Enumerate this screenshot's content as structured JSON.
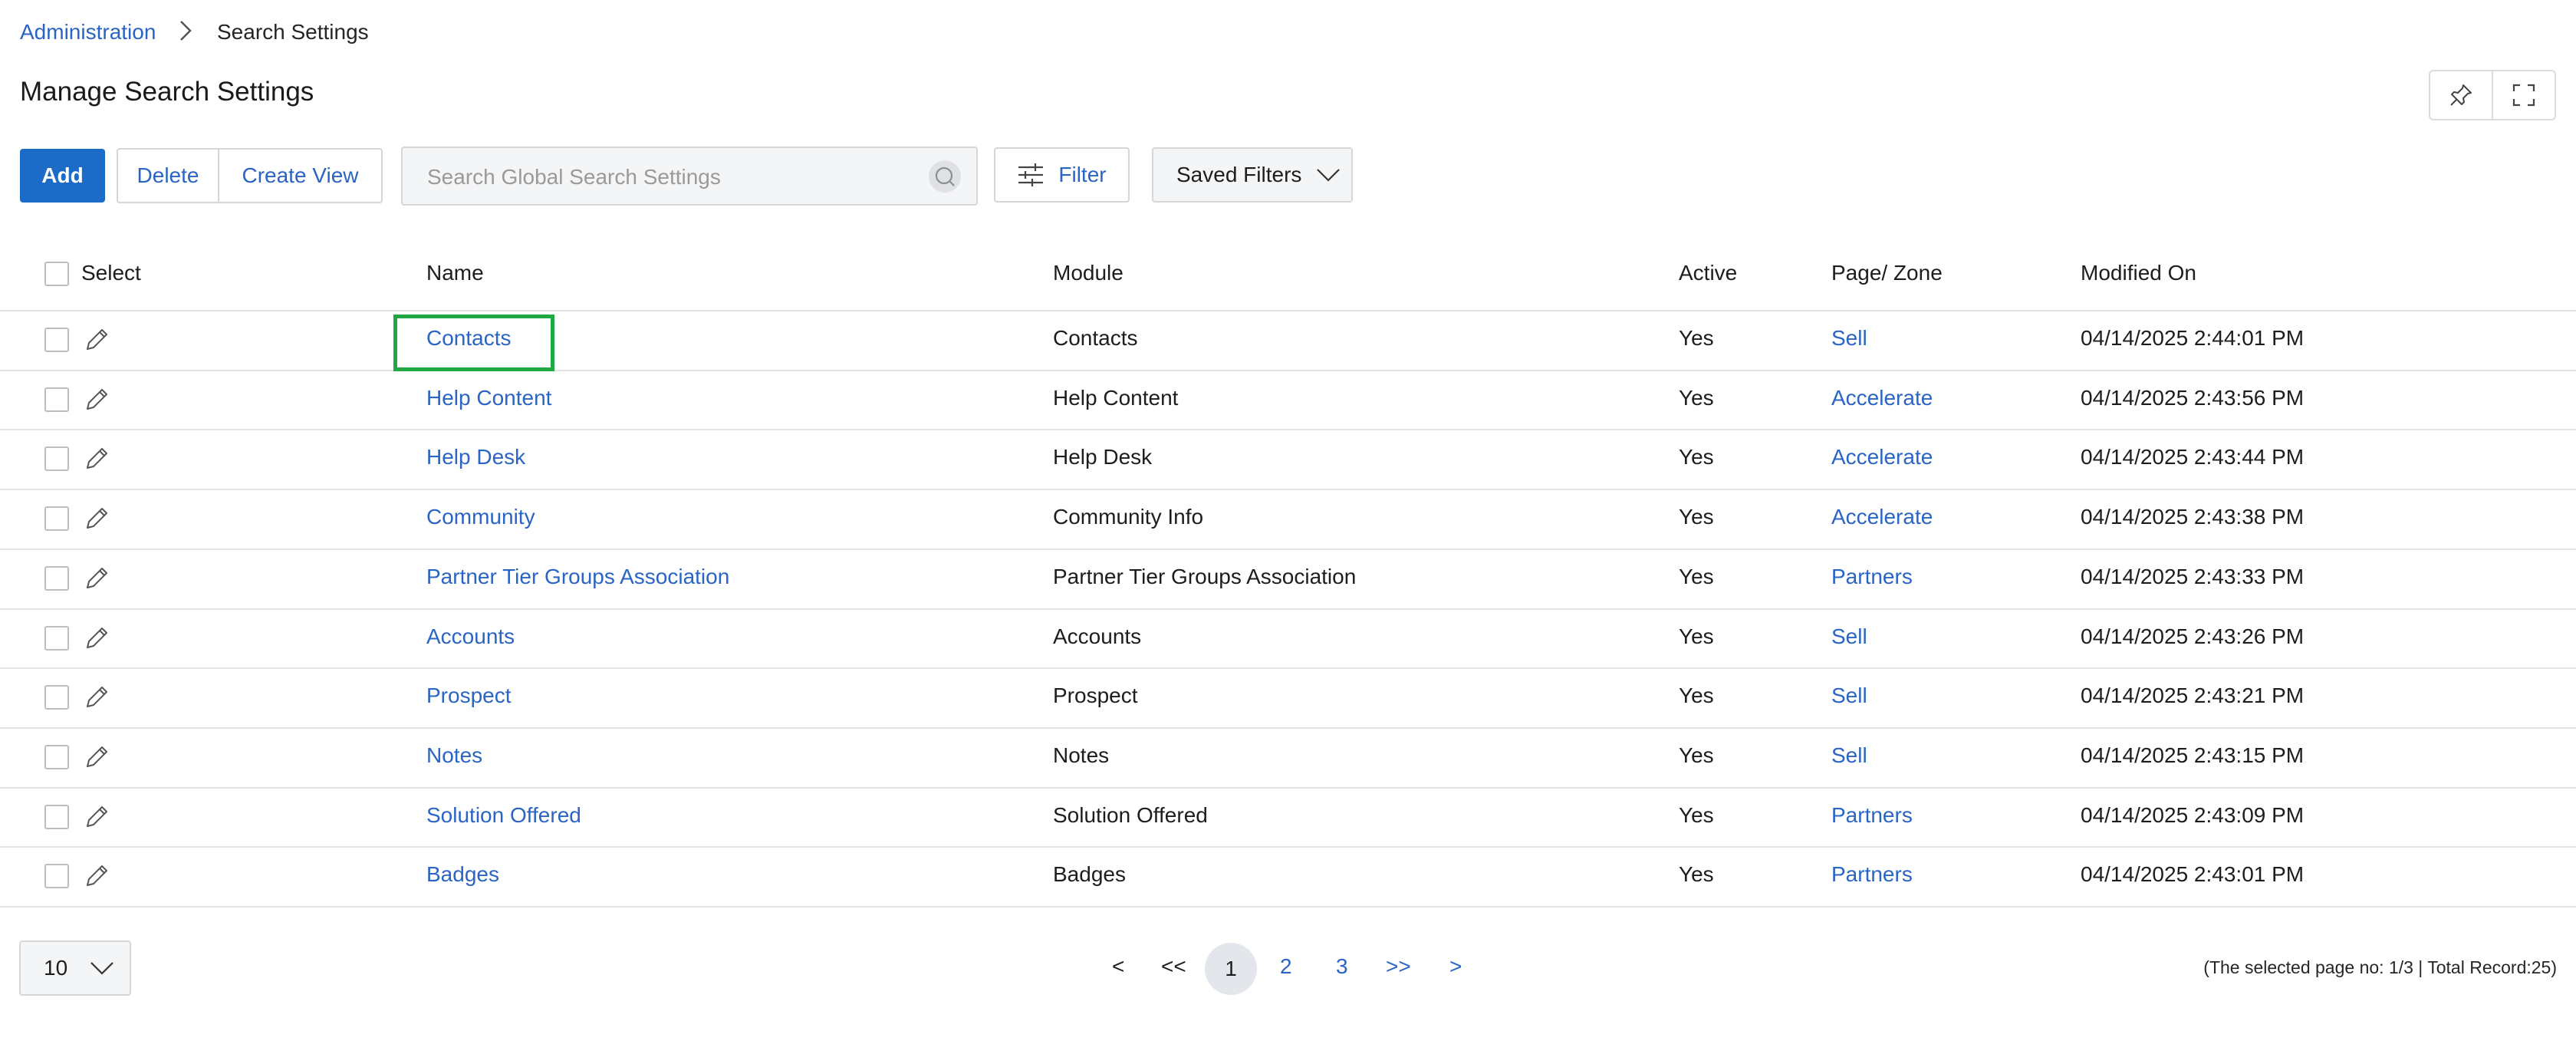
{
  "breadcrumb": {
    "parent": "Administration",
    "current": "Search Settings"
  },
  "page_title": "Manage Search Settings",
  "toolbar": {
    "add_label": "Add",
    "delete_label": "Delete",
    "create_view_label": "Create View",
    "search_placeholder": "Search Global Search Settings",
    "filter_label": "Filter",
    "saved_filters_label": "Saved Filters"
  },
  "table": {
    "headers": {
      "select": "Select",
      "name": "Name",
      "module": "Module",
      "active": "Active",
      "zone": "Page/ Zone",
      "modified": "Modified On"
    },
    "rows": [
      {
        "name": "Contacts",
        "module": "Contacts",
        "active": "Yes",
        "zone": "Sell",
        "modified": "04/14/2025 2:44:01 PM"
      },
      {
        "name": "Help Content",
        "module": "Help Content",
        "active": "Yes",
        "zone": "Accelerate",
        "modified": "04/14/2025 2:43:56 PM"
      },
      {
        "name": "Help Desk",
        "module": "Help Desk",
        "active": "Yes",
        "zone": "Accelerate",
        "modified": "04/14/2025 2:43:44 PM"
      },
      {
        "name": "Community",
        "module": "Community Info",
        "active": "Yes",
        "zone": "Accelerate",
        "modified": "04/14/2025 2:43:38 PM"
      },
      {
        "name": "Partner Tier Groups Association",
        "module": "Partner Tier Groups Association",
        "active": "Yes",
        "zone": "Partners",
        "modified": "04/14/2025 2:43:33 PM"
      },
      {
        "name": "Accounts",
        "module": "Accounts",
        "active": "Yes",
        "zone": "Sell",
        "modified": "04/14/2025 2:43:26 PM"
      },
      {
        "name": "Prospect",
        "module": "Prospect",
        "active": "Yes",
        "zone": "Sell",
        "modified": "04/14/2025 2:43:21 PM"
      },
      {
        "name": "Notes",
        "module": "Notes",
        "active": "Yes",
        "zone": "Sell",
        "modified": "04/14/2025 2:43:15 PM"
      },
      {
        "name": "Solution Offered",
        "module": "Solution Offered",
        "active": "Yes",
        "zone": "Partners",
        "modified": "04/14/2025 2:43:09 PM"
      },
      {
        "name": "Badges",
        "module": "Badges",
        "active": "Yes",
        "zone": "Partners",
        "modified": "04/14/2025 2:43:01 PM"
      }
    ]
  },
  "pagination": {
    "page_size": "10",
    "prev": "<",
    "first": "<<",
    "pages": [
      "1",
      "2",
      "3"
    ],
    "last": ">>",
    "next": ">",
    "info": "(The selected page no: 1/3 | Total Record:25)"
  },
  "colors": {
    "accent": "#1b6bc7",
    "link": "#2a64c5",
    "focus": "#1fa843"
  },
  "icons": {
    "breadcrumb_sep": "chevron-right-icon",
    "pin": "pin-icon",
    "fullscreen": "fullscreen-icon",
    "search": "search-icon",
    "filter": "sliders-icon",
    "dropdown": "chevron-down-icon",
    "edit": "pencil-icon"
  }
}
